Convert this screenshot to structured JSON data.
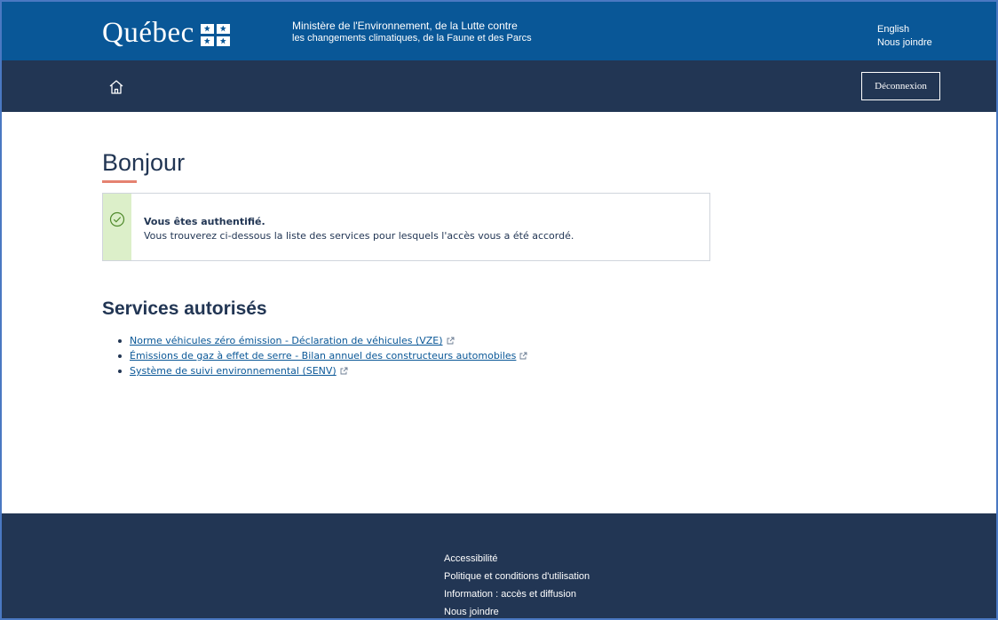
{
  "header": {
    "logo_text": "Québec",
    "ministry_line1": "Ministère de l'Environnement, de la Lutte contre",
    "ministry_line2": "les changements climatiques, de la Faune et des Parcs",
    "links": [
      "English",
      "Nous joindre"
    ],
    "color": "#095797"
  },
  "nav": {
    "home_icon": "home-icon",
    "logout_label": "Déconnexion",
    "color": "#223654"
  },
  "main": {
    "title": "Bonjour",
    "alert": {
      "icon": "check-circle-icon",
      "title": "Vous êtes authentifié.",
      "text": "Vous trouverez ci-dessous la liste des services pour lesquels l'accès vous a été accordé.",
      "accent_color": "#dcefc9"
    },
    "services_title": "Services autorisés",
    "services": [
      "Norme véhicules zéro émission - Déclaration de véhicules (VZE)",
      "Émissions de gaz à effet de serre - Bilan annuel des constructeurs automobiles",
      "Système de suivi environnemental (SENV)"
    ]
  },
  "footer": {
    "links": [
      "Accessibilité",
      "Politique et conditions d'utilisation",
      "Information : accès et diffusion",
      "Nous joindre"
    ]
  }
}
